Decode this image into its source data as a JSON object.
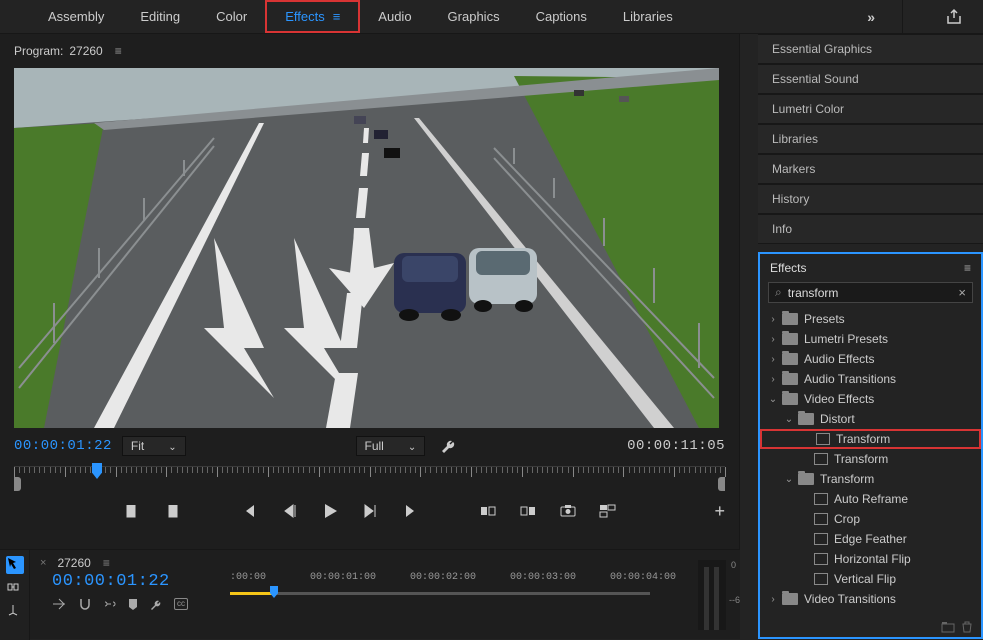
{
  "workspace_tabs": {
    "items": [
      "Assembly",
      "Editing",
      "Color",
      "Effects",
      "Audio",
      "Graphics",
      "Captions",
      "Libraries"
    ],
    "active_index": 3,
    "highlighted_index": 3
  },
  "program": {
    "label_prefix": "Program:",
    "sequence_name": "27260",
    "current_tc": "00:00:01:22",
    "duration_tc": "00:00:11:05",
    "zoom_label": "Fit",
    "quality_label": "Full"
  },
  "right_panels": [
    "Essential Graphics",
    "Essential Sound",
    "Lumetri Color",
    "Libraries",
    "Markers",
    "History",
    "Info"
  ],
  "effects": {
    "title": "Effects",
    "search": {
      "value": "transform",
      "placeholder": ""
    },
    "tree": [
      {
        "type": "folder",
        "label": "Presets",
        "indent": 0,
        "expand": ">"
      },
      {
        "type": "folder",
        "label": "Lumetri Presets",
        "indent": 0,
        "expand": ">"
      },
      {
        "type": "folder",
        "label": "Audio Effects",
        "indent": 0,
        "expand": ">"
      },
      {
        "type": "folder",
        "label": "Audio Transitions",
        "indent": 0,
        "expand": ">"
      },
      {
        "type": "folder",
        "label": "Video Effects",
        "indent": 0,
        "expand": "v"
      },
      {
        "type": "folder",
        "label": "Distort",
        "indent": 1,
        "expand": "v"
      },
      {
        "type": "preset",
        "label": "Transform",
        "indent": 2,
        "highlighted": true
      },
      {
        "type": "preset",
        "label": "Transform",
        "indent": 2
      },
      {
        "type": "folder",
        "label": "Transform",
        "indent": 1,
        "expand": "v"
      },
      {
        "type": "preset",
        "label": "Auto Reframe",
        "indent": 2
      },
      {
        "type": "preset",
        "label": "Crop",
        "indent": 2
      },
      {
        "type": "preset",
        "label": "Edge Feather",
        "indent": 2
      },
      {
        "type": "preset",
        "label": "Horizontal Flip",
        "indent": 2
      },
      {
        "type": "preset",
        "label": "Vertical Flip",
        "indent": 2
      },
      {
        "type": "folder",
        "label": "Video Transitions",
        "indent": 0,
        "expand": ">"
      }
    ]
  },
  "timeline": {
    "sequence_name": "27260",
    "current_tc": "00:00:01:22",
    "ruler_labels": [
      ":00:00",
      "00:00:01:00",
      "00:00:02:00",
      "00:00:03:00",
      "00:00:04:00"
    ],
    "meter": {
      "top": "0",
      "mid": "--6"
    }
  },
  "icons": {
    "chevron_right": "›",
    "chevron_down": "⌄",
    "menu": "≡",
    "overflow": "»",
    "close": "×",
    "search": "⌕",
    "plus": "+",
    "play": "▶",
    "step_back": "◀|",
    "step_fwd": "|▶",
    "go_start": "|◀◀",
    "go_end": "▶▶|",
    "in": "◧",
    "out": "◨",
    "marker": "▪",
    "lift": "⎘",
    "extract": "⎗",
    "camera": "📷",
    "export": "⏏",
    "wrench": "🔧",
    "snap": "⊓",
    "link": "⇄",
    "cc": "cc",
    "share": "⇧"
  }
}
